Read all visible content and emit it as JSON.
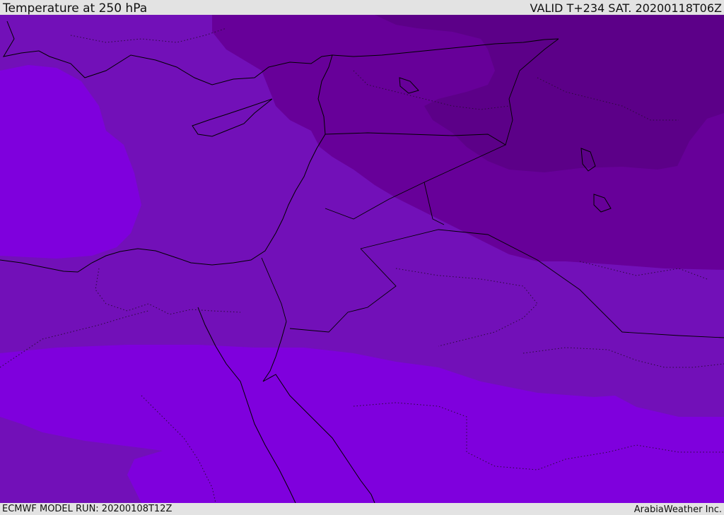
{
  "header": {
    "title": "Temperature at 250 hPa",
    "valid": "VALID T+234 SAT. 20200118T06Z"
  },
  "footer": {
    "model_run": "ECMWF MODEL RUN: 20200108T12Z",
    "credit": "ArabiaWeather Inc."
  },
  "colors": {
    "warm_band": "#7f00dd",
    "mid_band": "#7210b8",
    "cool_band": "#670099",
    "cold_band": "#5c0088",
    "coastline": "#000000"
  }
}
